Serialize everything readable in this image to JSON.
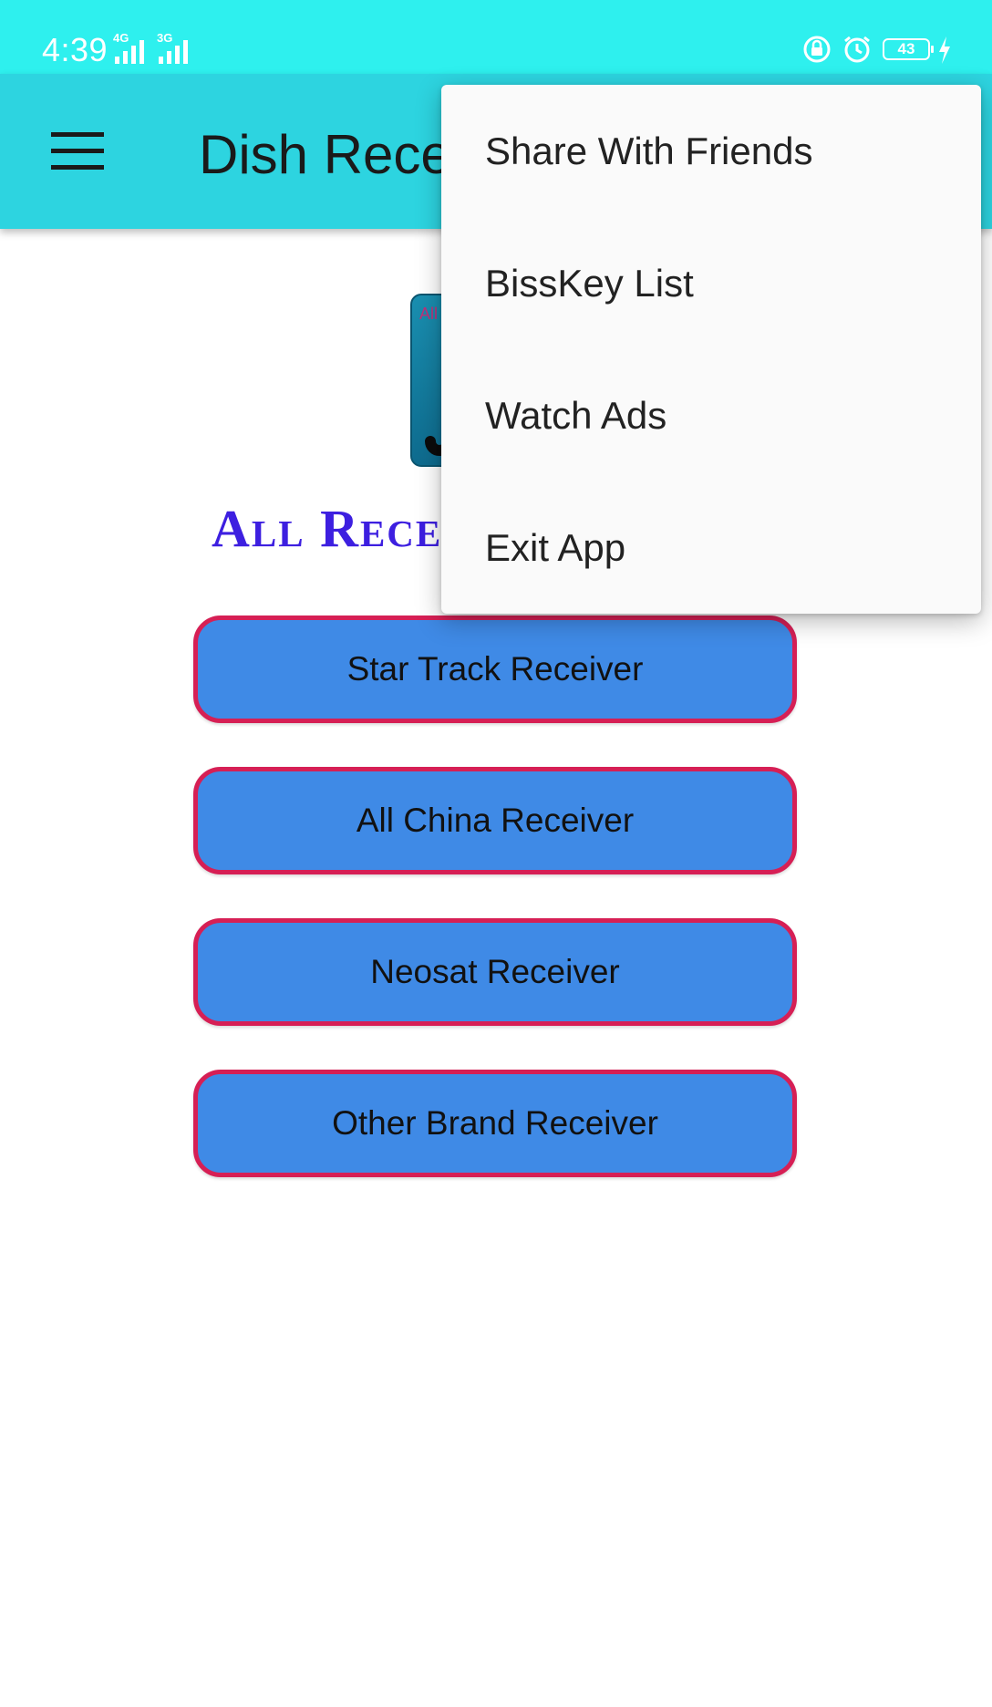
{
  "status_bar": {
    "time": "4:39",
    "network_1": "4G",
    "network_2": "3G",
    "battery": "43"
  },
  "app_bar": {
    "title": "Dish Rece"
  },
  "logo": {
    "text": "All"
  },
  "heading": "All Recei",
  "buttons": [
    {
      "label": "Star Track Receiver"
    },
    {
      "label": "All China Receiver"
    },
    {
      "label": "Neosat Receiver"
    },
    {
      "label": "Other Brand Receiver"
    }
  ],
  "overflow_menu": {
    "items": [
      {
        "label": "Share With Friends"
      },
      {
        "label": "BissKey List"
      },
      {
        "label": "Watch Ads"
      },
      {
        "label": "Exit App"
      }
    ]
  },
  "colors": {
    "status_bar": "#2ef0ee",
    "app_bar": "#2dd4e0",
    "button_fill": "#3f8ae6",
    "button_border": "#d61f55",
    "heading": "#3d1fe0",
    "menu_bg": "#fafafa"
  },
  "icons": [
    "menu-icon",
    "lock-rotation-icon",
    "alarm-icon",
    "battery-icon",
    "charging-icon",
    "signal-icon"
  ]
}
